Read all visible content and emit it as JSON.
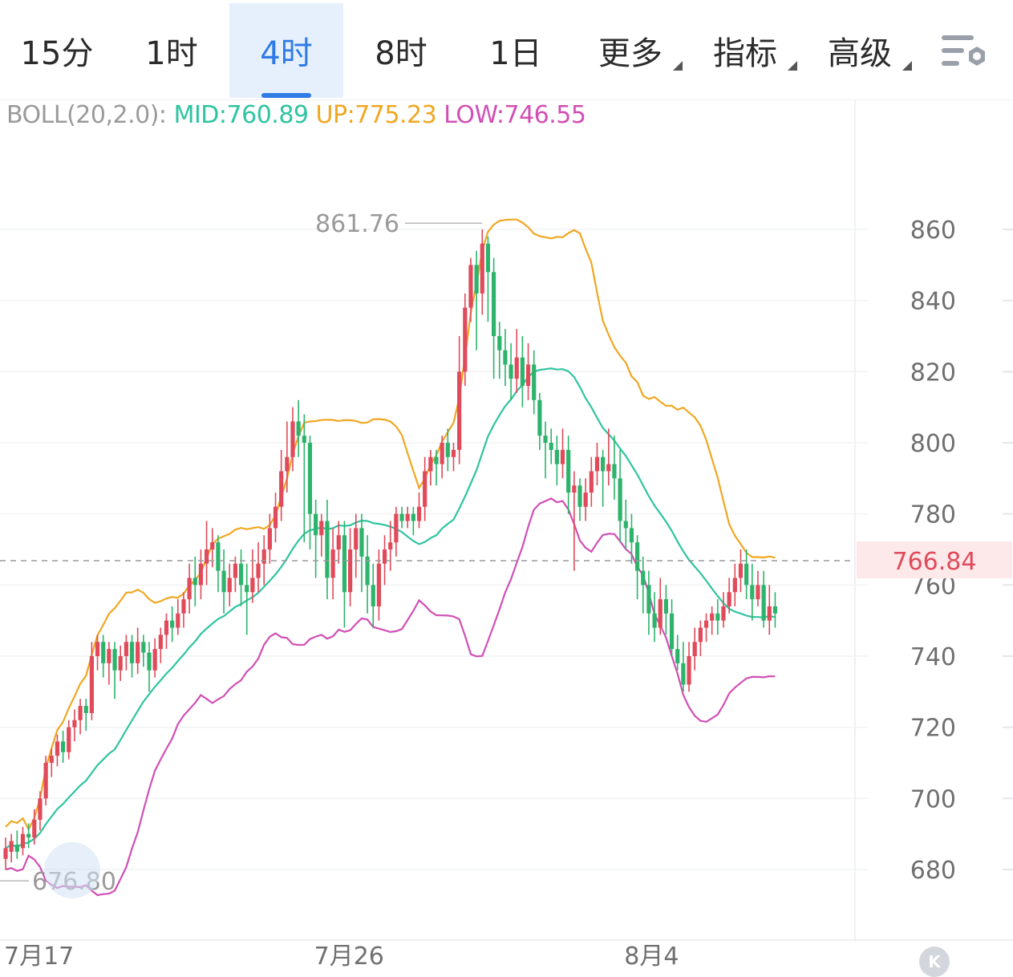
{
  "tabs": [
    {
      "label": "15分",
      "active": false,
      "dropdown": false
    },
    {
      "label": "1时",
      "active": false,
      "dropdown": false
    },
    {
      "label": "4时",
      "active": true,
      "dropdown": false
    },
    {
      "label": "8时",
      "active": false,
      "dropdown": false
    },
    {
      "label": "1日",
      "active": false,
      "dropdown": false
    },
    {
      "label": "更多",
      "active": false,
      "dropdown": true
    },
    {
      "label": "指标",
      "active": false,
      "dropdown": true
    },
    {
      "label": "高级",
      "active": false,
      "dropdown": true
    }
  ],
  "settings_icon": "chart-settings-icon",
  "indicator": {
    "name": "BOLL(20,2.0):",
    "mid": "MID:760.89",
    "up": "UP:775.23",
    "low": "LOW:746.55"
  },
  "colors": {
    "up_candle": "#e04a5a",
    "down_candle": "#2db36b",
    "mid": "#2fc4a0",
    "upper": "#f0a722",
    "lower": "#d14fb5",
    "active_tab": "#2f7be6",
    "last_price": "#e04a5a"
  },
  "chart_data": {
    "type": "candlestick",
    "y_ticks": [
      860,
      840,
      820,
      800,
      780,
      760,
      740,
      720,
      700,
      680
    ],
    "ylim": [
      670,
      880
    ],
    "x_ticks": [
      {
        "label": "7月17",
        "index": 0
      },
      {
        "label": "7月26",
        "index": 54
      },
      {
        "label": "8月4",
        "index": 108
      }
    ],
    "last_price": {
      "value": 766.84,
      "label": "766.84"
    },
    "high_marker": {
      "value": 861.76,
      "label": "861.76"
    },
    "low_marker": {
      "value": 676.8,
      "label": "676.80"
    },
    "candles": [
      [
        683,
        686,
        680,
        689
      ],
      [
        685,
        688,
        682,
        690
      ],
      [
        687,
        685,
        683,
        691
      ],
      [
        686,
        690,
        684,
        692
      ],
      [
        690,
        689,
        686,
        693
      ],
      [
        689,
        694,
        687,
        697
      ],
      [
        694,
        700,
        691,
        702
      ],
      [
        700,
        710,
        698,
        712
      ],
      [
        710,
        712,
        706,
        714
      ],
      [
        712,
        716,
        709,
        718
      ],
      [
        716,
        713,
        710,
        719
      ],
      [
        713,
        720,
        711,
        722
      ],
      [
        720,
        722,
        716,
        725
      ],
      [
        722,
        726,
        718,
        728
      ],
      [
        726,
        724,
        719,
        728
      ],
      [
        724,
        740,
        722,
        744
      ],
      [
        740,
        744,
        736,
        746
      ],
      [
        744,
        738,
        734,
        746
      ],
      [
        738,
        742,
        732,
        744
      ],
      [
        742,
        736,
        728,
        744
      ],
      [
        736,
        740,
        733,
        743
      ],
      [
        740,
        744,
        736,
        746
      ],
      [
        744,
        738,
        734,
        746
      ],
      [
        738,
        744,
        735,
        748
      ],
      [
        744,
        741,
        737,
        746
      ],
      [
        741,
        736,
        730,
        744
      ],
      [
        736,
        742,
        734,
        745
      ],
      [
        742,
        746,
        738,
        748
      ],
      [
        746,
        750,
        742,
        752
      ],
      [
        750,
        748,
        744,
        754
      ],
      [
        748,
        752,
        746,
        756
      ],
      [
        752,
        756,
        748,
        758
      ],
      [
        756,
        762,
        752,
        766
      ],
      [
        762,
        760,
        754,
        768
      ],
      [
        760,
        766,
        756,
        770
      ],
      [
        766,
        770,
        760,
        778
      ],
      [
        770,
        772,
        765,
        776
      ],
      [
        772,
        764,
        758,
        774
      ],
      [
        764,
        758,
        752,
        770
      ],
      [
        758,
        762,
        754,
        766
      ],
      [
        762,
        766,
        758,
        768
      ],
      [
        766,
        760,
        754,
        770
      ],
      [
        760,
        758,
        746,
        766
      ],
      [
        758,
        762,
        755,
        770
      ],
      [
        762,
        766,
        758,
        772
      ],
      [
        766,
        770,
        760,
        774
      ],
      [
        770,
        776,
        766,
        780
      ],
      [
        776,
        782,
        772,
        786
      ],
      [
        782,
        792,
        778,
        798
      ],
      [
        792,
        796,
        786,
        806
      ],
      [
        796,
        806,
        792,
        810
      ],
      [
        806,
        802,
        796,
        812
      ],
      [
        802,
        800,
        772,
        808
      ],
      [
        800,
        780,
        770,
        802
      ],
      [
        780,
        774,
        762,
        784
      ],
      [
        774,
        778,
        768,
        780
      ],
      [
        778,
        762,
        756,
        784
      ],
      [
        762,
        770,
        756,
        776
      ],
      [
        770,
        774,
        766,
        778
      ],
      [
        774,
        758,
        748,
        778
      ],
      [
        758,
        770,
        754,
        776
      ],
      [
        770,
        776,
        762,
        780
      ],
      [
        776,
        768,
        758,
        780
      ],
      [
        768,
        760,
        752,
        774
      ],
      [
        760,
        754,
        748,
        766
      ],
      [
        754,
        766,
        750,
        770
      ],
      [
        766,
        770,
        760,
        774
      ],
      [
        770,
        772,
        764,
        778
      ],
      [
        772,
        780,
        768,
        782
      ],
      [
        780,
        778,
        776,
        782
      ],
      [
        778,
        780,
        776,
        782
      ],
      [
        780,
        778,
        774,
        782
      ],
      [
        778,
        782,
        776,
        786
      ],
      [
        782,
        792,
        778,
        796
      ],
      [
        792,
        796,
        788,
        798
      ],
      [
        796,
        794,
        788,
        798
      ],
      [
        794,
        800,
        790,
        802
      ],
      [
        800,
        796,
        792,
        804
      ],
      [
        796,
        798,
        792,
        800
      ],
      [
        798,
        820,
        794,
        830
      ],
      [
        820,
        838,
        816,
        842
      ],
      [
        838,
        850,
        834,
        852
      ],
      [
        850,
        842,
        826,
        854
      ],
      [
        842,
        856,
        836,
        860
      ],
      [
        856,
        848,
        834,
        858
      ],
      [
        848,
        830,
        818,
        852
      ],
      [
        830,
        826,
        818,
        834
      ],
      [
        826,
        822,
        816,
        832
      ],
      [
        822,
        818,
        812,
        828
      ],
      [
        818,
        824,
        814,
        832
      ],
      [
        824,
        816,
        810,
        830
      ],
      [
        816,
        822,
        812,
        828
      ],
      [
        822,
        812,
        808,
        826
      ],
      [
        812,
        802,
        798,
        814
      ],
      [
        802,
        800,
        790,
        806
      ],
      [
        800,
        798,
        794,
        804
      ],
      [
        798,
        794,
        788,
        802
      ],
      [
        794,
        798,
        790,
        804
      ],
      [
        798,
        786,
        780,
        802
      ],
      [
        786,
        788,
        764,
        792
      ],
      [
        788,
        782,
        778,
        790
      ],
      [
        782,
        786,
        778,
        790
      ],
      [
        786,
        792,
        782,
        796
      ],
      [
        792,
        796,
        788,
        800
      ],
      [
        796,
        792,
        782,
        798
      ],
      [
        792,
        794,
        788,
        804
      ],
      [
        794,
        790,
        784,
        802
      ],
      [
        790,
        778,
        772,
        798
      ],
      [
        778,
        776,
        770,
        784
      ],
      [
        776,
        772,
        766,
        780
      ],
      [
        772,
        764,
        756,
        774
      ],
      [
        764,
        760,
        752,
        768
      ],
      [
        760,
        752,
        746,
        764
      ],
      [
        752,
        748,
        744,
        758
      ],
      [
        748,
        756,
        746,
        762
      ],
      [
        756,
        752,
        746,
        760
      ],
      [
        752,
        742,
        740,
        756
      ],
      [
        742,
        738,
        736,
        746
      ],
      [
        738,
        732,
        730,
        744
      ],
      [
        732,
        740,
        730,
        744
      ],
      [
        740,
        744,
        736,
        748
      ],
      [
        744,
        748,
        740,
        750
      ],
      [
        748,
        750,
        744,
        752
      ],
      [
        750,
        752,
        746,
        754
      ],
      [
        752,
        750,
        746,
        756
      ],
      [
        750,
        754,
        748,
        758
      ],
      [
        754,
        758,
        752,
        762
      ],
      [
        758,
        762,
        754,
        766
      ],
      [
        762,
        766,
        758,
        770
      ],
      [
        766,
        760,
        756,
        770
      ],
      [
        760,
        756,
        750,
        766
      ],
      [
        756,
        760,
        754,
        764
      ],
      [
        760,
        750,
        748,
        764
      ],
      [
        750,
        754,
        746,
        760
      ],
      [
        754,
        752,
        748,
        758
      ]
    ]
  }
}
